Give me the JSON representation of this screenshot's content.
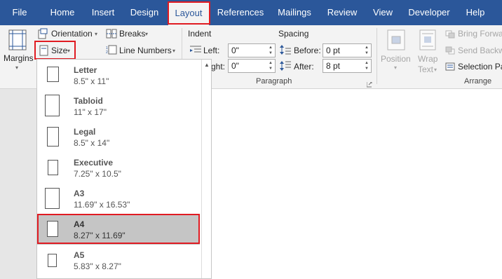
{
  "menu_tabs": [
    "File",
    "Home",
    "Insert",
    "Design",
    "Layout",
    "References",
    "Mailings",
    "Review",
    "View",
    "Developer",
    "Help"
  ],
  "active_tab": "Layout",
  "ribbon": {
    "margins": "Margins",
    "orientation": "Orientation",
    "size": "Size",
    "breaks": "Breaks",
    "line_numbers": "Line Numbers",
    "indent_heading": "Indent",
    "indent_left_label": "Left:",
    "indent_left_value": "0\"",
    "indent_right_label": "ght:",
    "indent_right_value": "0\"",
    "spacing_heading": "Spacing",
    "before_label": "Before:",
    "before_value": "0 pt",
    "after_label": "After:",
    "after_value": "8 pt",
    "paragraph_group": "Paragraph",
    "position": "Position",
    "wrap_text_1": "Wrap",
    "wrap_text_2": "Text",
    "bring_forward": "Bring Forwa",
    "send_backward": "Send Backw",
    "selection_pane": "Selection Pa",
    "arrange_group": "Arrange"
  },
  "size_options": [
    {
      "name": "Letter",
      "dims": "8.5\" x 11\""
    },
    {
      "name": "Tabloid",
      "dims": "11\" x 17\""
    },
    {
      "name": "Legal",
      "dims": "8.5\" x 14\""
    },
    {
      "name": "Executive",
      "dims": "7.25\" x 10.5\""
    },
    {
      "name": "A3",
      "dims": "11.69\" x 16.53\""
    },
    {
      "name": "A4",
      "dims": "8.27\" x 11.69\""
    },
    {
      "name": "A5",
      "dims": "5.83\" x 8.27\""
    }
  ],
  "selected_size": "A4",
  "colors": {
    "brand": "#2b579a",
    "highlight": "#e01b22",
    "selected_bg": "#c5c5c5"
  }
}
